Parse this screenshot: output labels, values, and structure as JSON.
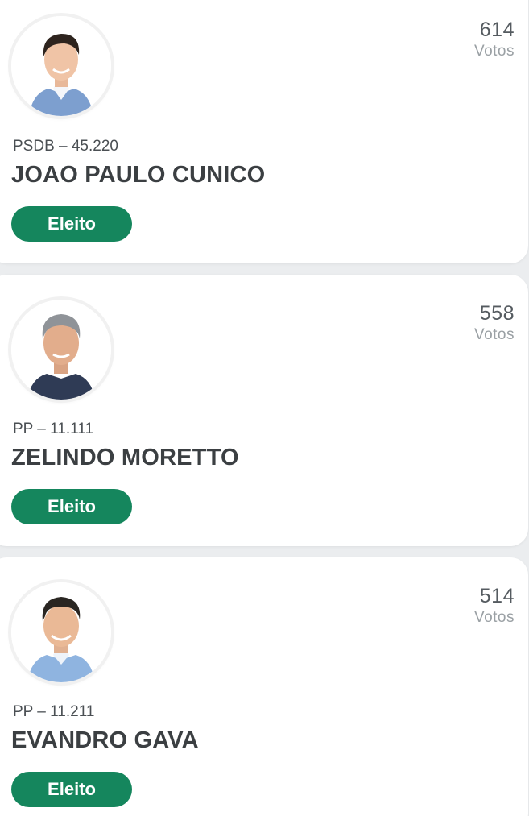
{
  "candidates": [
    {
      "votes": "614",
      "votes_label": "Votos",
      "party": "PSDB – 45.220",
      "name": "JOAO PAULO CUNICO",
      "status": "Eleito"
    },
    {
      "votes": "558",
      "votes_label": "Votos",
      "party": "PP – 11.111",
      "name": "ZELINDO MORETTO",
      "status": "Eleito"
    },
    {
      "votes": "514",
      "votes_label": "Votos",
      "party": "PP – 11.211",
      "name": "EVANDRO GAVA",
      "status": "Eleito"
    }
  ],
  "colors": {
    "badge_green": "#15865d",
    "page_background": "#ebedef",
    "card_background": "#ffffff"
  }
}
